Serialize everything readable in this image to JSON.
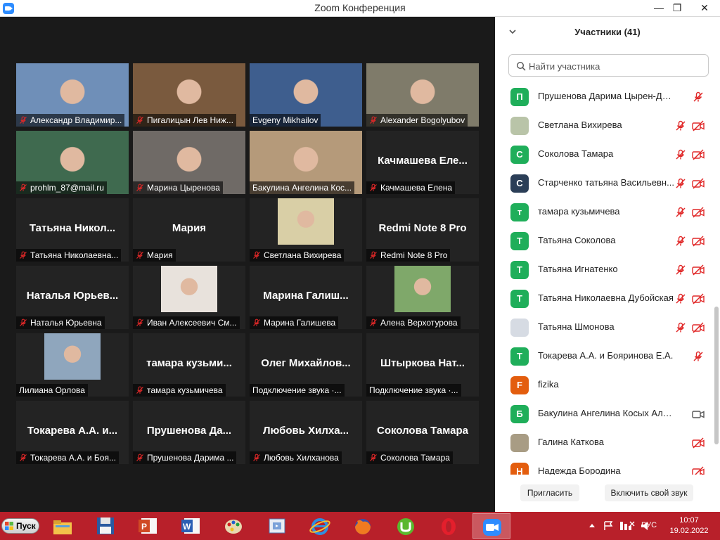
{
  "window": {
    "title": "Zoom Конференция",
    "min": "—",
    "max": "❐",
    "close": "✕"
  },
  "tiles": [
    {
      "big": "",
      "label": "Александр Владимир...",
      "muted": true,
      "pic": "#6f8fb8"
    },
    {
      "big": "",
      "label": "Пигалицын Лев Ниж...",
      "muted": true,
      "pic": "#7a5a3e"
    },
    {
      "big": "",
      "label": "Evgeny Mikhailov",
      "muted": false,
      "pic": "#3e5e8e",
      "active": true
    },
    {
      "big": "",
      "label": "Alexander Bogolyubov",
      "muted": true,
      "pic": "#7f7b6a"
    },
    {
      "big": "",
      "label": "prohlm_87@mail.ru",
      "muted": true,
      "pic": "#3f6a4f"
    },
    {
      "big": "",
      "label": "Марина Цыренова",
      "muted": true,
      "pic": "#6f6a66"
    },
    {
      "big": "",
      "label": "Бакулина Ангелина Кос...",
      "muted": false,
      "pic": "#b59a7a"
    },
    {
      "big": "Качмашева Еле...",
      "label": "Качмашева Елена",
      "muted": true
    },
    {
      "big": "Татьяна Никол...",
      "label": "Татьяна Николаевна...",
      "muted": true
    },
    {
      "big": "Мария",
      "label": "Мария",
      "muted": true
    },
    {
      "big": "",
      "label": "Светлана Вихирева",
      "muted": true,
      "inset": "#d9cfa6"
    },
    {
      "big": "Redmi Note 8 Pro",
      "label": "Redmi Note 8 Pro",
      "muted": true
    },
    {
      "big": "Наталья Юрьев...",
      "label": "Наталья Юрьевна",
      "muted": true
    },
    {
      "big": "",
      "label": "Иван Алексеевич См...",
      "muted": true,
      "inset": "#e8e2dc"
    },
    {
      "big": "Марина Галиш...",
      "label": "Марина Галишева",
      "muted": true
    },
    {
      "big": "",
      "label": "Алена Верхотурова",
      "muted": true,
      "inset": "#7fa86a"
    },
    {
      "big": "",
      "label": "Лилиана Орлова",
      "muted": false,
      "inset": "#8fa6bd"
    },
    {
      "big": "тамара кузьми...",
      "label": "тамара кузьмичева",
      "muted": true
    },
    {
      "big": "Олег Михайлов...",
      "label": "Подключение звука ·...",
      "muted": false
    },
    {
      "big": "Штыркова Нат...",
      "label": "Подключение звука ·...",
      "muted": false
    },
    {
      "big": "Токарева А.А. и...",
      "label": "Токарева А.А. и Боя...",
      "muted": true
    },
    {
      "big": "Прушенова Да...",
      "label": "Прушенова Дарима ...",
      "muted": true
    },
    {
      "big": "Любовь Хилха...",
      "label": "Любовь Хилханова",
      "muted": true
    },
    {
      "big": "Соколова Тамара",
      "label": "Соколова Тамара",
      "muted": true
    }
  ],
  "sidebar": {
    "title": "Участники (41)",
    "search_placeholder": "Найти участника",
    "invite": "Пригласить",
    "unmute": "Включить свой звук",
    "participants": [
      {
        "initial": "П",
        "color": "#1fae5a",
        "name": "Прушенова Дарима Цырен-Дорж...",
        "mic": true,
        "cam": false
      },
      {
        "initial": "",
        "color": "#b9c4a8",
        "name": "Светлана Вихирева",
        "mic": true,
        "cam": true
      },
      {
        "initial": "С",
        "color": "#1fae5a",
        "name": "Соколова Тамара",
        "mic": true,
        "cam": true
      },
      {
        "initial": "С",
        "color": "#2b3e57",
        "name": "Старченко татьяна Васильевн...",
        "mic": true,
        "cam": true
      },
      {
        "initial": "т",
        "color": "#1fae5a",
        "name": "тамара кузьмичева",
        "mic": true,
        "cam": true
      },
      {
        "initial": "Т",
        "color": "#1fae5a",
        "name": "Татьяна Соколова",
        "mic": true,
        "cam": true
      },
      {
        "initial": "Т",
        "color": "#1fae5a",
        "name": "Татьяна Игнатенко",
        "mic": true,
        "cam": true
      },
      {
        "initial": "Т",
        "color": "#1fae5a",
        "name": "Татьяна Николаевна Дубойская",
        "mic": true,
        "cam": true
      },
      {
        "initial": "",
        "color": "#d6dbe3",
        "name": "Татьяна Шмонова",
        "mic": true,
        "cam": true
      },
      {
        "initial": "Т",
        "color": "#1fae5a",
        "name": "Токарева А.А. и Бояринова Е.А.",
        "mic": true,
        "cam": false
      },
      {
        "initial": "F",
        "color": "#e35d0e",
        "name": "fizika",
        "mic": false,
        "cam": false
      },
      {
        "initial": "Б",
        "color": "#1fae5a",
        "name": "Бакулина Ангелина Косых Алексан...",
        "mic": false,
        "cam": "on"
      },
      {
        "initial": "",
        "color": "#a89c84",
        "name": "Галина Каткова",
        "mic": false,
        "cam": true
      },
      {
        "initial": "Н",
        "color": "#e35d0e",
        "name": "Надежда Бородина",
        "mic": false,
        "cam": true
      }
    ]
  },
  "taskbar": {
    "start": "Пуск",
    "apps": [
      "file-explorer-icon",
      "floppy-disk-icon",
      "powerpoint-icon",
      "word-icon",
      "paint-icon",
      "app-icon",
      "internet-explorer-icon",
      "firefox-icon",
      "utorrent-icon",
      "opera-icon",
      "zoom-icon"
    ],
    "lang": "РУС",
    "time": "10:07",
    "date": "19.02.2022"
  },
  "colors": {
    "accent": "#2d8cff",
    "muted_red": "#e02828",
    "active_speaker": "#c6e33a",
    "taskbar": "#b8202a"
  }
}
